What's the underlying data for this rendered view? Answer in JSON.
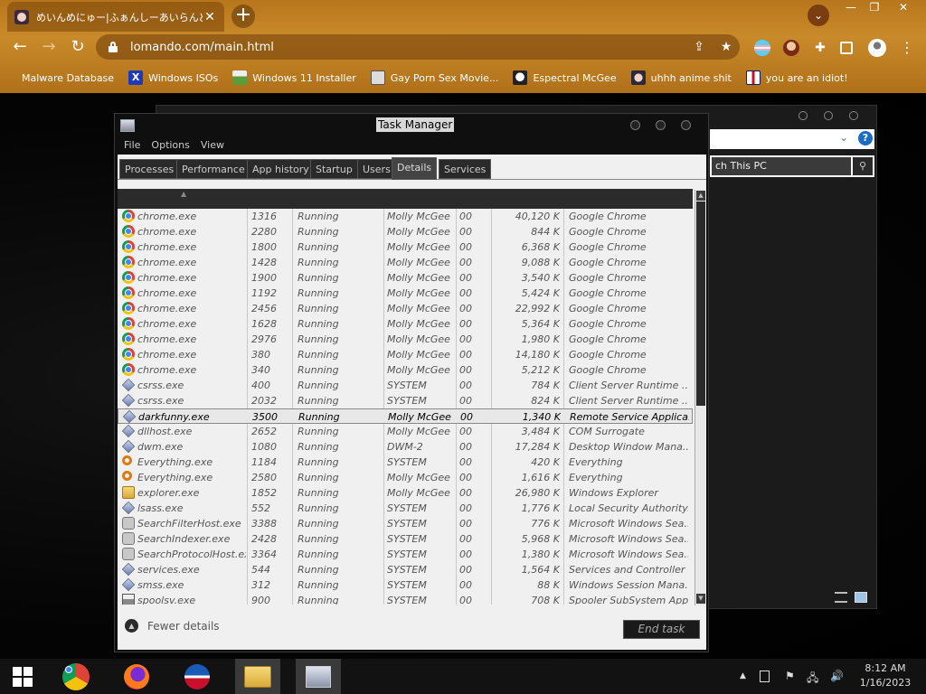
{
  "browser": {
    "tab_title": "めいんめにゅー|ふぁんしーあいらんど",
    "tab_close": "✕",
    "new_tab": "+",
    "url": "lomando.com/main.html",
    "window_controls": [
      "—",
      "❐",
      "✕"
    ],
    "bookmarks": [
      {
        "label": "Malware Database",
        "icon": "malware-icon"
      },
      {
        "label": "Windows ISOs",
        "icon": "x-logo-icon"
      },
      {
        "label": "Windows 11 Installer",
        "icon": "image-icon"
      },
      {
        "label": "Gay Porn Sex Movie...",
        "icon": "bot-icon"
      },
      {
        "label": "Espectral McGee",
        "icon": "face-icon"
      },
      {
        "label": "uhhh anime shit",
        "icon": "anime-icon"
      },
      {
        "label": "you are an idiot!",
        "icon": "flag-icon"
      }
    ]
  },
  "explorer": {
    "search_placeholder": "ch This PC"
  },
  "taskmgr": {
    "title": "Task Manager",
    "menu": [
      "File",
      "Options",
      "View"
    ],
    "tabs": [
      "Processes",
      "Performance",
      "App history",
      "Startup",
      "Users",
      "Details",
      "Services"
    ],
    "active_tab": "Details",
    "rows": [
      {
        "name": "chrome.exe",
        "pid": "1316",
        "status": "Running",
        "user": "Molly McGee",
        "cpu": "00",
        "mem": "40,120 K",
        "desc": "Google Chrome",
        "icon": "chrome"
      },
      {
        "name": "chrome.exe",
        "pid": "2280",
        "status": "Running",
        "user": "Molly McGee",
        "cpu": "00",
        "mem": "844 K",
        "desc": "Google Chrome",
        "icon": "chrome"
      },
      {
        "name": "chrome.exe",
        "pid": "1800",
        "status": "Running",
        "user": "Molly McGee",
        "cpu": "00",
        "mem": "6,368 K",
        "desc": "Google Chrome",
        "icon": "chrome"
      },
      {
        "name": "chrome.exe",
        "pid": "1428",
        "status": "Running",
        "user": "Molly McGee",
        "cpu": "00",
        "mem": "9,088 K",
        "desc": "Google Chrome",
        "icon": "chrome"
      },
      {
        "name": "chrome.exe",
        "pid": "1900",
        "status": "Running",
        "user": "Molly McGee",
        "cpu": "00",
        "mem": "3,540 K",
        "desc": "Google Chrome",
        "icon": "chrome"
      },
      {
        "name": "chrome.exe",
        "pid": "1192",
        "status": "Running",
        "user": "Molly McGee",
        "cpu": "00",
        "mem": "5,424 K",
        "desc": "Google Chrome",
        "icon": "chrome"
      },
      {
        "name": "chrome.exe",
        "pid": "2456",
        "status": "Running",
        "user": "Molly McGee",
        "cpu": "00",
        "mem": "22,992 K",
        "desc": "Google Chrome",
        "icon": "chrome"
      },
      {
        "name": "chrome.exe",
        "pid": "1628",
        "status": "Running",
        "user": "Molly McGee",
        "cpu": "00",
        "mem": "5,364 K",
        "desc": "Google Chrome",
        "icon": "chrome"
      },
      {
        "name": "chrome.exe",
        "pid": "2976",
        "status": "Running",
        "user": "Molly McGee",
        "cpu": "00",
        "mem": "1,980 K",
        "desc": "Google Chrome",
        "icon": "chrome"
      },
      {
        "name": "chrome.exe",
        "pid": "380",
        "status": "Running",
        "user": "Molly McGee",
        "cpu": "00",
        "mem": "14,180 K",
        "desc": "Google Chrome",
        "icon": "chrome"
      },
      {
        "name": "chrome.exe",
        "pid": "340",
        "status": "Running",
        "user": "Molly McGee",
        "cpu": "00",
        "mem": "5,212 K",
        "desc": "Google Chrome",
        "icon": "chrome"
      },
      {
        "name": "csrss.exe",
        "pid": "400",
        "status": "Running",
        "user": "SYSTEM",
        "cpu": "00",
        "mem": "784 K",
        "desc": "Client Server Runtime ...",
        "icon": "diamond"
      },
      {
        "name": "csrss.exe",
        "pid": "2032",
        "status": "Running",
        "user": "SYSTEM",
        "cpu": "00",
        "mem": "824 K",
        "desc": "Client Server Runtime ...",
        "icon": "diamond"
      },
      {
        "name": "darkfunny.exe",
        "pid": "3500",
        "status": "Running",
        "user": "Molly McGee",
        "cpu": "00",
        "mem": "1,340 K",
        "desc": "Remote Service Applica...",
        "icon": "diamond",
        "selected": true
      },
      {
        "name": "dllhost.exe",
        "pid": "2652",
        "status": "Running",
        "user": "Molly McGee",
        "cpu": "00",
        "mem": "3,484 K",
        "desc": "COM Surrogate",
        "icon": "diamond"
      },
      {
        "name": "dwm.exe",
        "pid": "1080",
        "status": "Running",
        "user": "DWM-2",
        "cpu": "00",
        "mem": "17,284 K",
        "desc": "Desktop Window Mana...",
        "icon": "diamond"
      },
      {
        "name": "Everything.exe",
        "pid": "1184",
        "status": "Running",
        "user": "SYSTEM",
        "cpu": "00",
        "mem": "420 K",
        "desc": "Everything",
        "icon": "search"
      },
      {
        "name": "Everything.exe",
        "pid": "2580",
        "status": "Running",
        "user": "Molly McGee",
        "cpu": "00",
        "mem": "1,616 K",
        "desc": "Everything",
        "icon": "search"
      },
      {
        "name": "explorer.exe",
        "pid": "1852",
        "status": "Running",
        "user": "Molly McGee",
        "cpu": "00",
        "mem": "26,980 K",
        "desc": "Windows Explorer",
        "icon": "folder"
      },
      {
        "name": "lsass.exe",
        "pid": "552",
        "status": "Running",
        "user": "SYSTEM",
        "cpu": "00",
        "mem": "1,776 K",
        "desc": "Local Security Authority...",
        "icon": "diamond"
      },
      {
        "name": "SearchFilterHost.exe",
        "pid": "3388",
        "status": "Running",
        "user": "SYSTEM",
        "cpu": "00",
        "mem": "776 K",
        "desc": "Microsoft Windows Sea...",
        "icon": "gear"
      },
      {
        "name": "SearchIndexer.exe",
        "pid": "2428",
        "status": "Running",
        "user": "SYSTEM",
        "cpu": "00",
        "mem": "5,968 K",
        "desc": "Microsoft Windows Sea...",
        "icon": "gear"
      },
      {
        "name": "SearchProtocolHost.exe",
        "pid": "3364",
        "status": "Running",
        "user": "SYSTEM",
        "cpu": "00",
        "mem": "1,380 K",
        "desc": "Microsoft Windows Sea...",
        "icon": "gear"
      },
      {
        "name": "services.exe",
        "pid": "544",
        "status": "Running",
        "user": "SYSTEM",
        "cpu": "00",
        "mem": "1,564 K",
        "desc": "Services and Controller ...",
        "icon": "diamond"
      },
      {
        "name": "smss.exe",
        "pid": "312",
        "status": "Running",
        "user": "SYSTEM",
        "cpu": "00",
        "mem": "88 K",
        "desc": "Windows Session Mana...",
        "icon": "diamond"
      },
      {
        "name": "spoolsv.exe",
        "pid": "900",
        "status": "Running",
        "user": "SYSTEM",
        "cpu": "00",
        "mem": "708 K",
        "desc": "Spooler SubSystem App",
        "icon": "printer"
      }
    ],
    "fewer_details": "Fewer details",
    "end_task": "End task"
  },
  "taskbar": {
    "time": "8:12 AM",
    "date": "1/16/2023"
  }
}
